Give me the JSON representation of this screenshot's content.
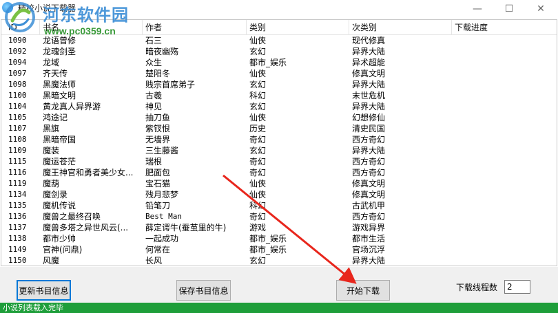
{
  "window": {
    "title": "精校小说下载器",
    "minimize_glyph": "—",
    "maximize_glyph": "☐",
    "close_glyph": "✕"
  },
  "watermark": {
    "name": "河东软件园",
    "url": "www.pc0359.cn"
  },
  "table": {
    "columns": [
      "ID",
      "书名",
      "作者",
      "类别",
      "次类别",
      "下载进度"
    ],
    "rows": [
      [
        "1090",
        "龙语曾修",
        "石三",
        "仙侠",
        "现代修真",
        ""
      ],
      [
        "1092",
        "龙魂剑圣",
        "暗夜幽殇",
        "玄幻",
        "异界大陆",
        ""
      ],
      [
        "1094",
        "龙域",
        "众生",
        "都市_娱乐",
        "异术超能",
        ""
      ],
      [
        "1097",
        "齐天传",
        "楚阳冬",
        "仙侠",
        "修真文明",
        ""
      ],
      [
        "1098",
        "黑魔法师",
        "贱宗首席弟子",
        "玄幻",
        "异界大陆",
        ""
      ],
      [
        "1100",
        "黑暗文明",
        "古羲",
        "科幻",
        "末世危机",
        ""
      ],
      [
        "1104",
        "黄龙真人异界游",
        "神见",
        "玄幻",
        "异界大陆",
        ""
      ],
      [
        "1105",
        "鸿途记",
        "抽刀鱼",
        "仙侠",
        "幻想修仙",
        ""
      ],
      [
        "1107",
        "黑旗",
        "紫钗恨",
        "历史",
        "清史民国",
        ""
      ],
      [
        "1108",
        "黑暗帝国",
        "无墙界",
        "奇幻",
        "西方奇幻",
        ""
      ],
      [
        "1109",
        "魔装",
        "三生藤酱",
        "玄幻",
        "异界大陆",
        ""
      ],
      [
        "1115",
        "魔运苍茫",
        "瑞根",
        "奇幻",
        "西方奇幻",
        ""
      ],
      [
        "1116",
        "魔王神官和勇者美少女...",
        "肥面包",
        "奇幻",
        "西方奇幻",
        ""
      ],
      [
        "1119",
        "魔葫",
        "宝石猫",
        "仙侠",
        "修真文明",
        ""
      ],
      [
        "1134",
        "魔剑录",
        "残月悲梦",
        "仙侠",
        "修真文明",
        ""
      ],
      [
        "1135",
        "魔机传说",
        "铅笔刀",
        "科幻",
        "古武机甲",
        ""
      ],
      [
        "1136",
        "魔兽之最终召唤",
        "Best Man",
        "奇幻",
        "西方奇幻",
        ""
      ],
      [
        "1137",
        "魔兽多塔之异世风云(...",
        "薛定谔牛(蚕茧里的牛)",
        "游戏",
        "游戏异界",
        ""
      ],
      [
        "1138",
        "都市少帅",
        "一起成功",
        "都市_娱乐",
        "都市生活",
        ""
      ],
      [
        "1149",
        "官神(问鼎)",
        "何常在",
        "都市_娱乐",
        "官场沉浮",
        ""
      ],
      [
        "1150",
        "风魔",
        "长风",
        "玄幻",
        "异界大陆",
        ""
      ]
    ]
  },
  "buttons": {
    "update": "更新书目信息",
    "save": "保存书目信息",
    "start": "开始下载"
  },
  "thread": {
    "label": "下载线程数",
    "value": "2"
  },
  "status": {
    "text": "小说列表载入完毕"
  },
  "colors": {
    "status_bar": "#1e9e3a",
    "focus_border": "#0078d7",
    "annotation_arrow": "#e8261c",
    "watermark_name": "#3d8fd6",
    "watermark_url": "#3a9a3a"
  }
}
